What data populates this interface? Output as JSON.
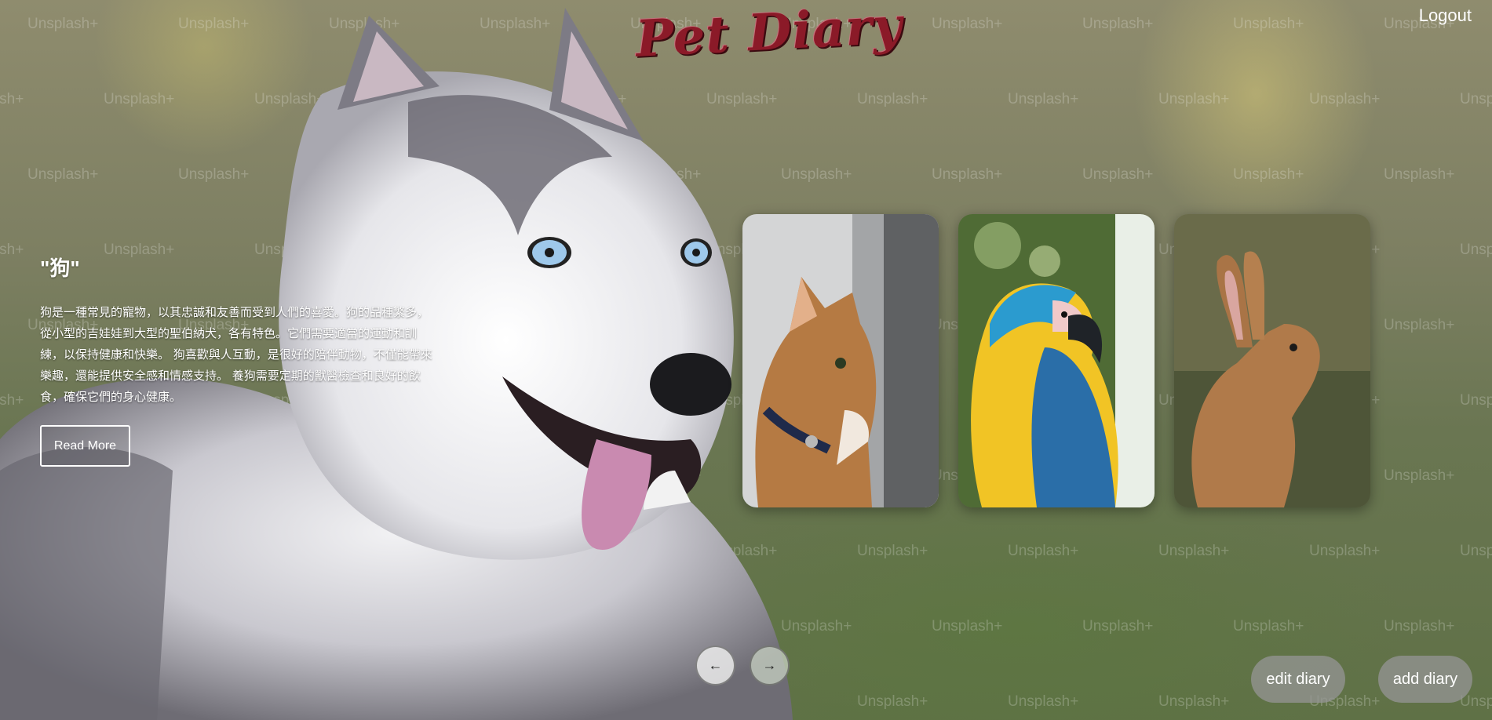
{
  "header": {
    "brand": "Pet Diary",
    "logout_label": "Logout"
  },
  "feature": {
    "title": "\"狗\"",
    "description": "狗是一種常見的寵物，以其忠誠和友善而受到人們的喜愛。狗的品種繁多， 從小型的吉娃娃到大型的聖伯納犬，各有特色。它們需要適當的運動和訓練，以保持健康和快樂。 狗喜歡與人互動，是很好的陪伴動物，不僅能帶來樂趣，還能提供安全感和情感支持。 養狗需要定期的獸醫檢查和良好的飲食，確保它們的身心健康。",
    "read_more_label": "Read More"
  },
  "cards": [
    {
      "name": "cat-card",
      "icon": "cat-photo"
    },
    {
      "name": "parrot-card",
      "icon": "parrot-photo"
    },
    {
      "name": "rabbit-card",
      "icon": "rabbit-photo"
    }
  ],
  "carousel": {
    "prev_icon": "arrow-left-icon",
    "next_icon": "arrow-right-icon"
  },
  "actions": {
    "edit_label": "edit diary",
    "add_label": "add diary"
  },
  "background": {
    "watermark": "Unsplash+"
  },
  "colors": {
    "brand": "#8b1a28",
    "text": "#ffffff",
    "pill": "#969696"
  }
}
